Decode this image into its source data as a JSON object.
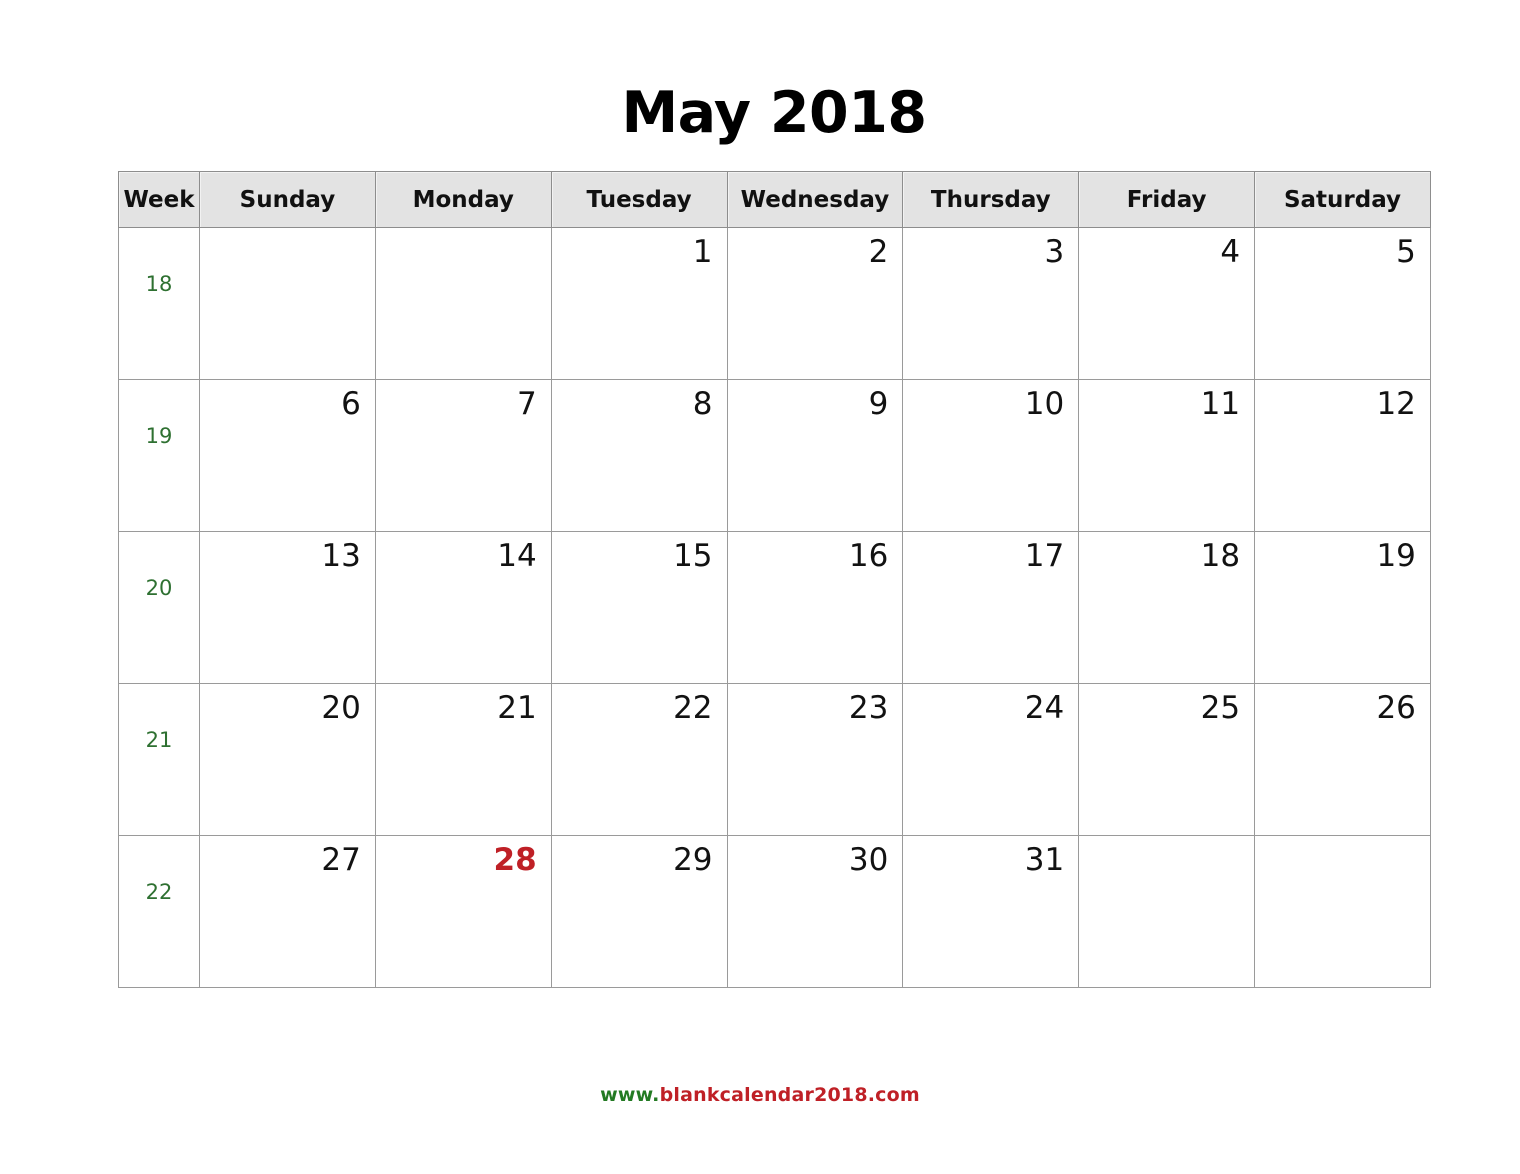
{
  "title": "May 2018",
  "colors": {
    "week_number": "#2e7031",
    "highlight_day": "#bf2026",
    "header_background": "#e3e3e3",
    "grid_border": "#8d8d8d",
    "footer_green": "#237a23",
    "footer_red": "#bf2026"
  },
  "headers": [
    "Week",
    "Sunday",
    "Monday",
    "Tuesday",
    "Wednesday",
    "Thursday",
    "Friday",
    "Saturday"
  ],
  "weeks": [
    {
      "week_number": "18",
      "days": [
        "",
        "",
        "1",
        "2",
        "3",
        "4",
        "5"
      ]
    },
    {
      "week_number": "19",
      "days": [
        "6",
        "7",
        "8",
        "9",
        "10",
        "11",
        "12"
      ]
    },
    {
      "week_number": "20",
      "days": [
        "13",
        "14",
        "15",
        "16",
        "17",
        "18",
        "19"
      ]
    },
    {
      "week_number": "21",
      "days": [
        "20",
        "21",
        "22",
        "23",
        "24",
        "25",
        "26"
      ]
    },
    {
      "week_number": "22",
      "days": [
        "27",
        "28",
        "29",
        "30",
        "31",
        "",
        ""
      ]
    }
  ],
  "highlighted_day": "28",
  "footer": {
    "prefix": "www.",
    "domain": "blankcalendar2018.com"
  }
}
